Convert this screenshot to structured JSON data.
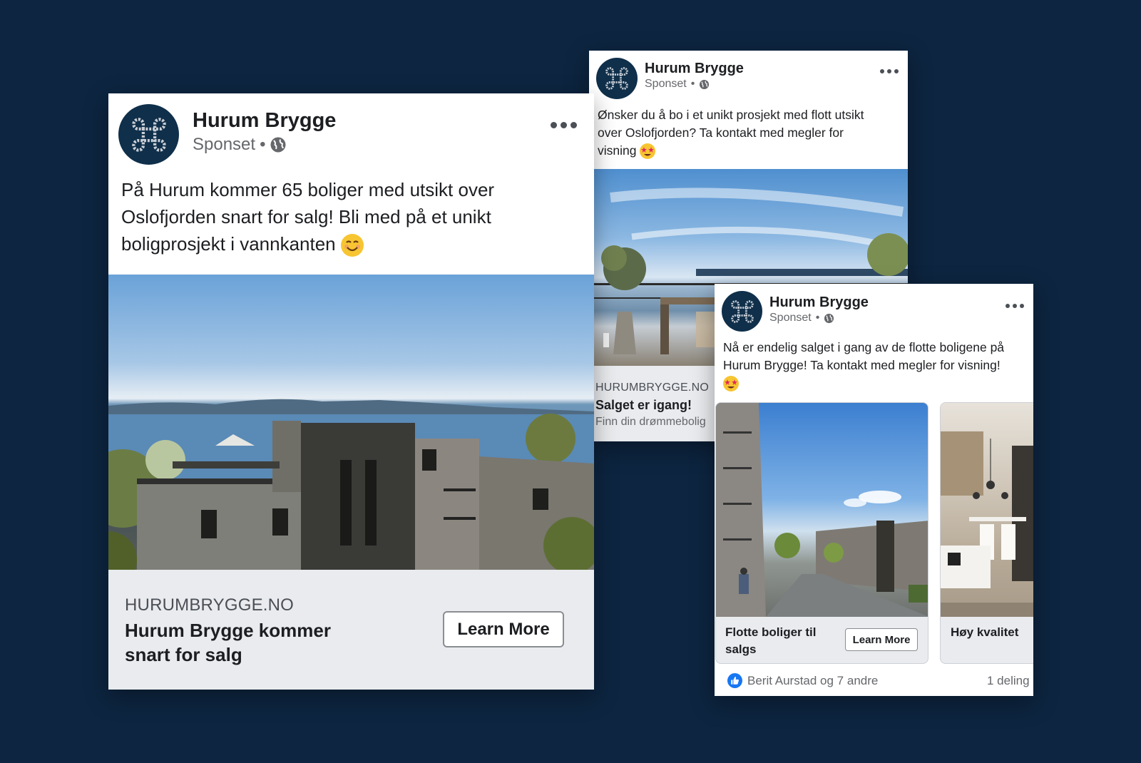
{
  "colors": {
    "background": "#0d2540",
    "avatar": "#0f2f4a",
    "cta_bar": "#e9ebee",
    "like_blue": "#1877f2"
  },
  "ad_main": {
    "page_name": "Hurum Brygge",
    "sponsored": "Sponset",
    "text": "På Hurum kommer 65 boliger med utsikt over Oslofjorden snart for salg! Bli med på et unikt boligprosjekt i vannkanten",
    "domain": "HURUMBRYGGE.NO",
    "headline": "Hurum Brygge kommer snart for salg",
    "cta": "Learn More",
    "emoji": "smiling-face-icon"
  },
  "ad_top": {
    "page_name": "Hurum Brygge",
    "sponsored": "Sponset",
    "text": "Ønsker du å bo i et unikt prosjekt med flott utsikt over Oslofjorden? Ta kontakt med megler for visning",
    "domain": "HURUMBRYGGE.NO",
    "headline": "Salget er igang!",
    "description": "Finn din drømmebolig",
    "emoji": "star-struck-icon"
  },
  "ad_carousel": {
    "page_name": "Hurum Brygge",
    "sponsored": "Sponset",
    "text": "Nå er endelig salget i gang av de flotte boligene på Hurum Brygge! Ta kontakt med megler for visning!",
    "emoji": "star-struck-icon",
    "cards": [
      {
        "title": "Flotte boliger til salgs",
        "cta": "Learn More"
      },
      {
        "title": "Høy kvalitet"
      }
    ],
    "reactions": "Berit Aurstad og 7 andre",
    "shares": "1 deling"
  }
}
